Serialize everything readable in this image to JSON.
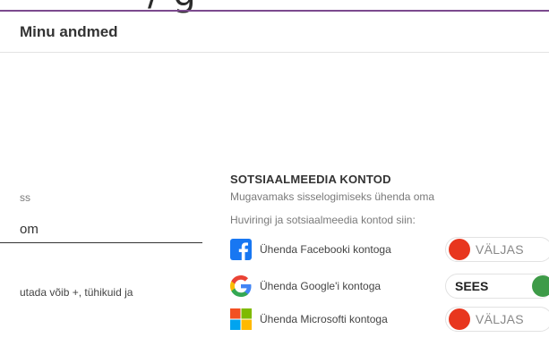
{
  "top_fragment": "/ g",
  "header": {
    "title": "Minu andmed"
  },
  "left_form": {
    "label_fragment": "ss",
    "value_fragment": "om",
    "hint_fragment": "utada võib +, tühikuid ja"
  },
  "social": {
    "title": "SOTSIAALMEEDIA KONTOD",
    "desc_line1": "Mugavamaks sisselogimiseks ühenda oma",
    "desc_line2": "Huviringi ja sotsiaalmeedia kontod siin:",
    "accounts": [
      {
        "label": "Ühenda Facebooki kontoga",
        "status": "VÄLJAS",
        "icon": "facebook-logo"
      },
      {
        "label": "Ühenda Google'i kontoga",
        "status": "SEES",
        "icon": "google-logo"
      },
      {
        "label": "Ühenda Microsofti kontoga",
        "status": "VÄLJAS",
        "icon": "microsoft-logo"
      }
    ]
  },
  "colors": {
    "accent_line": "#7b4a8e",
    "off_knob": "#e8361e",
    "on_knob": "#3e9b48",
    "facebook_blue": "#1877f2"
  }
}
